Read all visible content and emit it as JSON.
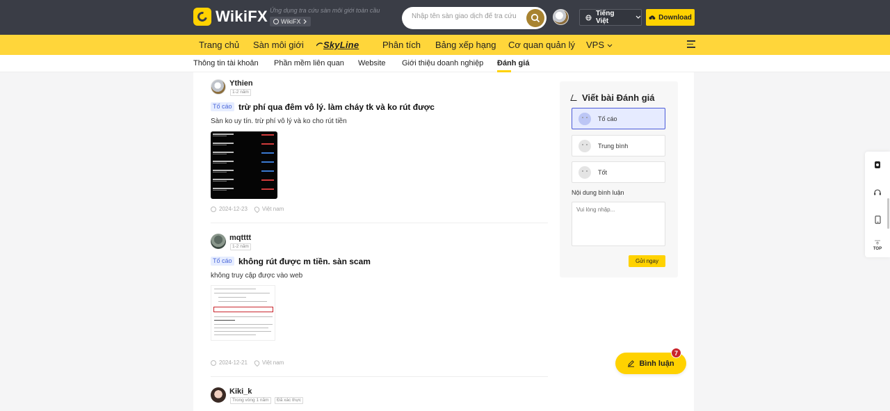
{
  "header": {
    "brand": "WikiFX",
    "tagline": "Ứng dụng tra cứu sàn môi giới toàn cầu",
    "pill_label": "WikiFX",
    "search_placeholder": "Nhập tên sàn giao dịch để tra cứu",
    "language": "Tiếng Việt",
    "download": "Download"
  },
  "nav": {
    "items": [
      "Trang chủ",
      "Sàn môi giới",
      "SkyLine",
      "Phân tích",
      "Bảng xếp hạng",
      "Cơ quan quản lý",
      "VPS"
    ]
  },
  "subtabs": {
    "items": [
      "Thông tin tài khoản",
      "Phần mềm liên quan",
      "Website",
      "Giới thiệu doanh nghiệp",
      "Đánh giá"
    ],
    "active_index": 4
  },
  "reviews": [
    {
      "user": "Ythien",
      "tags": [
        "1-2 năm"
      ],
      "badge": "Tố cáo",
      "title": "trừ phí qua đêm vô lý. làm cháy tk và ko rút được",
      "body": "Sàn ko uy tín. trừ phí vô lý và ko cho rút tiền",
      "date": "2024-12-23",
      "location": "Việt nam"
    },
    {
      "user": "mqtttt",
      "tags": [
        "1-2 năm"
      ],
      "badge": "Tố cáo",
      "title": "không rút được m tiền. sàn scam",
      "body": "không truy cập được vào web",
      "date": "2024-12-21",
      "location": "Việt nam"
    },
    {
      "user": "Kiki_k",
      "tags": [
        "Trong vòng 1 năm",
        "Đã xác thực"
      ]
    }
  ],
  "write_review": {
    "title": "Viết bài Đánh giá",
    "options": [
      "Tố cáo",
      "Trung bình",
      "Tốt"
    ],
    "selected_index": 0,
    "content_label": "Nội dung bình luận",
    "content_placeholder": "Vui lòng nhập...",
    "submit": "Gửi ngay"
  },
  "float_tools": {
    "top_label": "TOP"
  },
  "comment_fab": {
    "label": "Bình luận",
    "count": "7"
  },
  "colors": {
    "brand_yellow": "#ffd200",
    "header_dark": "#3a3d46",
    "badge_blue": "#4a66d9",
    "count_red": "#c9252c"
  }
}
